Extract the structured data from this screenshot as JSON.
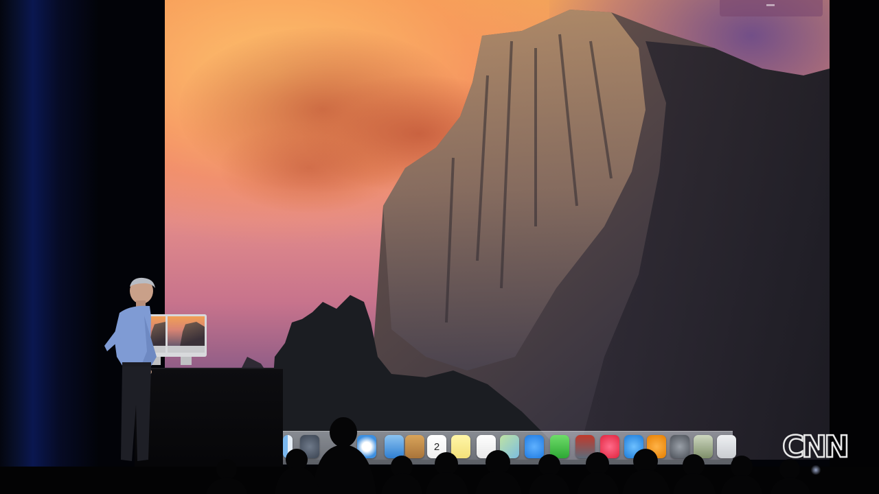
{
  "scene": {
    "description_type": "keynote-stage",
    "projected_desktop": {
      "wallpaper": "yosemite-half-dome",
      "dock_icons": [
        "finder-icon",
        "launchpad-icon",
        "safari-icon",
        "mail-icon",
        "contacts-icon",
        "calendar-icon",
        "notes-icon",
        "reminders-icon",
        "maps-icon",
        "messages-icon",
        "facetime-icon",
        "photo-booth-icon",
        "itunes-icon",
        "app-store-icon",
        "ibooks-icon",
        "system-preferences-icon",
        "iphoto-icon",
        "trash-icon"
      ],
      "calendar_day": "2"
    },
    "watermark": {
      "text": "CNN"
    }
  },
  "colors": {
    "sky_top": "#f3a35a",
    "sky_bottom": "#5d4a78",
    "cnn_logo": "#e9e9e9"
  }
}
